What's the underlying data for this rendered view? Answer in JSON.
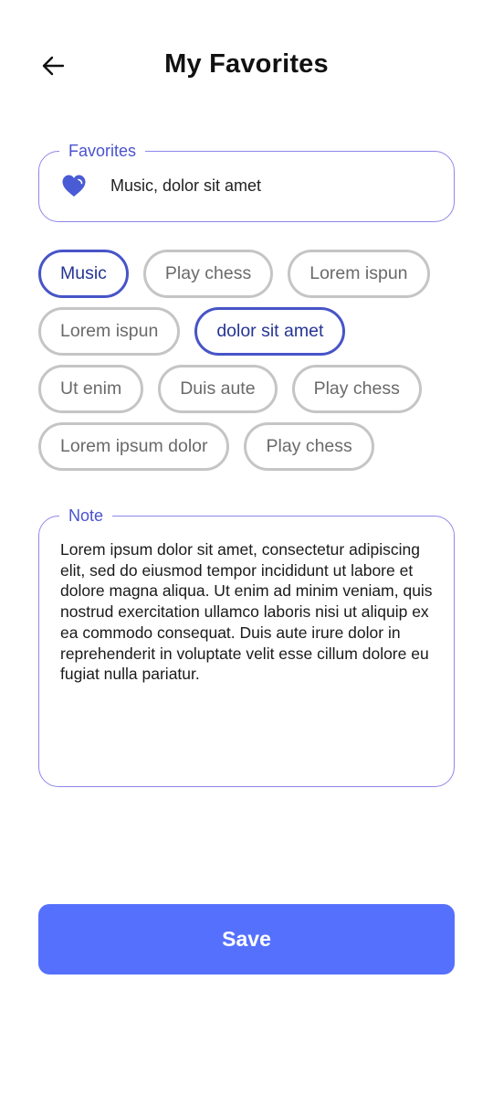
{
  "header": {
    "title": "My Favorites",
    "back_icon": "arrow-left-icon"
  },
  "favorites_field": {
    "legend": "Favorites",
    "icon": "heart-icon",
    "value": "Music, dolor sit amet"
  },
  "chips": {
    "rows": [
      [
        {
          "label": "Music",
          "selected": true
        },
        {
          "label": "Play chess",
          "selected": false
        },
        {
          "label": "Lorem ispun",
          "selected": false
        }
      ],
      [
        {
          "label": "Lorem ispun",
          "selected": false
        },
        {
          "label": "dolor sit amet",
          "selected": true
        }
      ],
      [
        {
          "label": "Ut enim",
          "selected": false
        },
        {
          "label": "Duis aute",
          "selected": false
        },
        {
          "label": "Play chess",
          "selected": false
        }
      ],
      [
        {
          "label": "Lorem ipsum dolor",
          "selected": false
        },
        {
          "label": "Play chess",
          "selected": false
        }
      ]
    ]
  },
  "note_field": {
    "legend": "Note",
    "value": "Lorem ipsum dolor sit amet, consectetur adipiscing elit, sed do eiusmod tempor incididunt ut labore et dolore magna aliqua. Ut enim ad minim veniam, quis nostrud exercitation ullamco laboris nisi ut aliquip ex ea commodo consequat. Duis aute irure dolor in reprehenderit in voluptate velit esse cillum dolore eu fugiat nulla pariatur."
  },
  "actions": {
    "save_label": "Save"
  },
  "colors": {
    "accent": "#5670fe",
    "field_border": "#8f86ea",
    "legend_text": "#4a52cf",
    "chip_selected_border": "#4754c8",
    "chip_border": "#c5c5c5",
    "heart": "#4a5bd6"
  }
}
